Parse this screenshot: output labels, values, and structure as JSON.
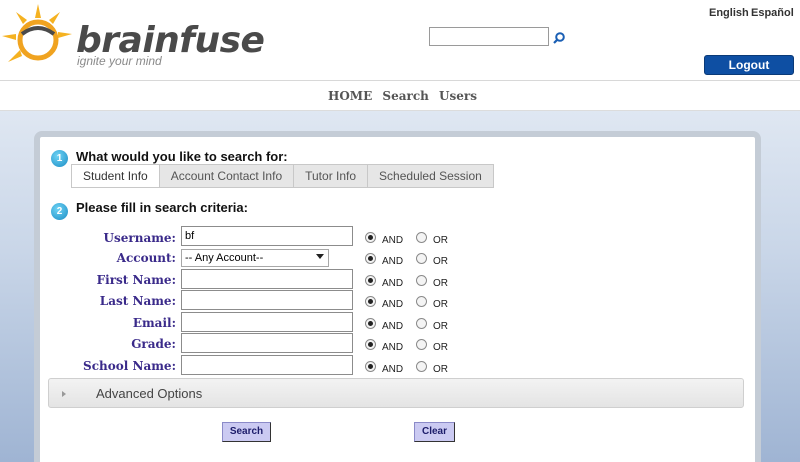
{
  "header": {
    "logo_text": "brainfuse",
    "tagline": "ignite your mind",
    "search_value": "",
    "lang_english": "English",
    "lang_spanish": "Español",
    "logout_label": "Logout"
  },
  "nav": {
    "items": [
      "HOME",
      "Search",
      "Users"
    ]
  },
  "form": {
    "step1": {
      "number": "1",
      "title": "What would you like to search for:"
    },
    "tabs": [
      "Student Info",
      "Account Contact Info",
      "Tutor Info",
      "Scheduled Session"
    ],
    "active_tab": "Student Info",
    "step2": {
      "number": "2",
      "title": "Please fill in search criteria:"
    },
    "fields": [
      {
        "label": "Username:",
        "value": "bf",
        "logic": "AND"
      },
      {
        "label": "Account:",
        "value": "-- Any Account--",
        "logic": "AND"
      },
      {
        "label": "First Name:",
        "value": "",
        "logic": "AND"
      },
      {
        "label": "Last Name:",
        "value": "",
        "logic": "AND"
      },
      {
        "label": "Email:",
        "value": "",
        "logic": "AND"
      },
      {
        "label": "Grade:",
        "value": "",
        "logic": "AND"
      },
      {
        "label": "School Name:",
        "value": "",
        "logic": "AND"
      }
    ],
    "and_label": "AND",
    "or_label": "OR",
    "advanced_label": "Advanced Options",
    "search_button": "Search",
    "clear_button": "Clear"
  },
  "colors": {
    "brand_blue": "#0e4fa3",
    "label_purple": "#3a2a8a",
    "button_lavender": "#cbcaf2"
  }
}
